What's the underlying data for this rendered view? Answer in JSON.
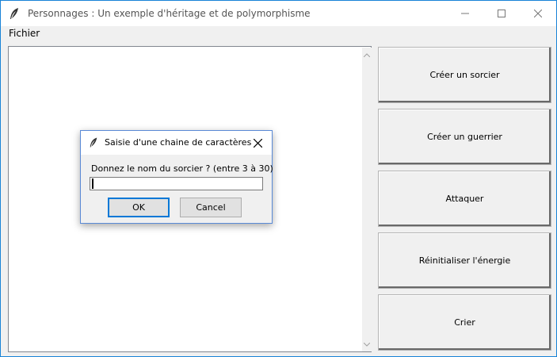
{
  "window": {
    "title": "Personnages : Un exemple d'héritage et de polymorphisme",
    "icon": "feather-icon"
  },
  "menubar": {
    "items": [
      {
        "label": "Fichier"
      }
    ]
  },
  "side_buttons": [
    {
      "label": "Créer un sorcier"
    },
    {
      "label": "Créer un guerrier"
    },
    {
      "label": "Attaquer"
    },
    {
      "label": "Réinitialiser l'énergie"
    },
    {
      "label": "Crier"
    }
  ],
  "dialog": {
    "title": "Saisie d'une chaine de caractères",
    "prompt": "Donnez le nom du sorcier ? (entre 3 à 30)",
    "input_value": "",
    "ok_label": "OK",
    "cancel_label": "Cancel"
  },
  "colors": {
    "window_border": "#1883d7",
    "dialog_border": "#5a8ad6",
    "focus_blue": "#0078d7"
  }
}
